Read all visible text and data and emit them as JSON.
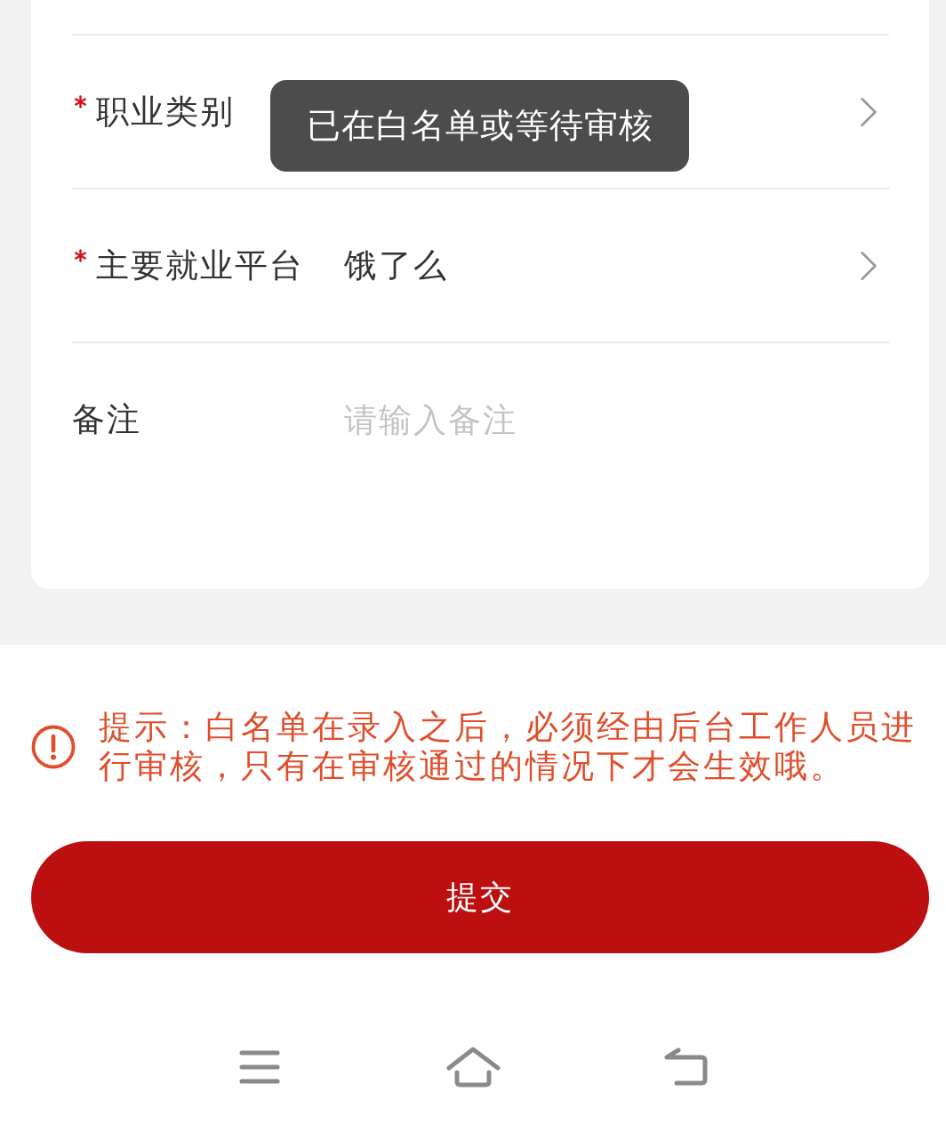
{
  "form": {
    "rows": [
      {
        "label": "职业类别",
        "required": true,
        "kind": "select"
      },
      {
        "label": "主要就业平台",
        "required": true,
        "kind": "select",
        "value": "饿了么"
      },
      {
        "label": "备注",
        "required": false,
        "kind": "input",
        "placeholder": "请输入备注"
      }
    ]
  },
  "toast": {
    "text": "已在白名单或等待审核"
  },
  "notice": {
    "text": "提示：白名单在录入之后，必须经由后台工作人员进行审核，只有在审核通过的情况下才会生效哦。"
  },
  "submit_button": {
    "label": "提交"
  }
}
